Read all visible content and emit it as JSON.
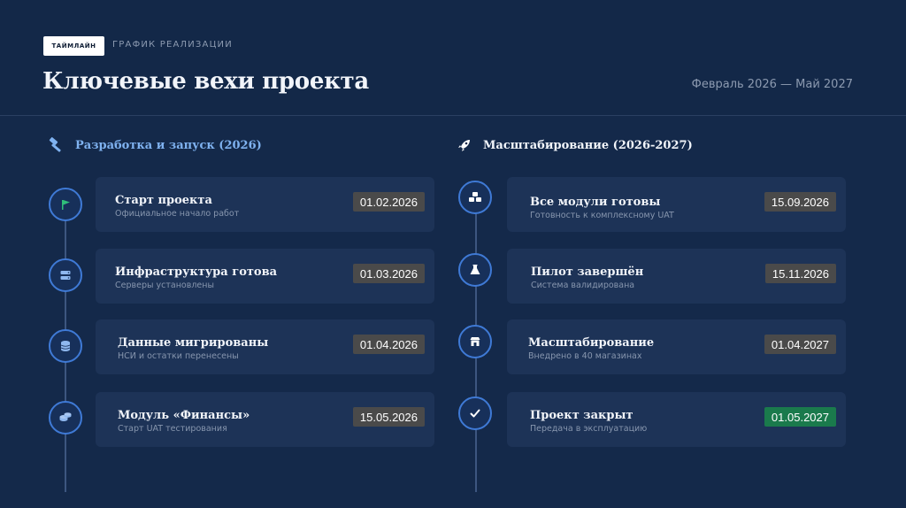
{
  "header": {
    "tag": "ТАЙМЛАЙН",
    "kicker": "ГРАФИК РЕАЛИЗАЦИИ",
    "title": "Ключевые вехи проекта",
    "date_range": "Февраль 2026 — Май 2027"
  },
  "left": {
    "heading": "Разработка и запуск (2026)",
    "heading_icon": "hammer-icon",
    "items": [
      {
        "title": "Старт проекта",
        "subtitle": "Официальное начало работ",
        "date": "01.02.2026",
        "icon": "flag-icon"
      },
      {
        "title": "Инфраструктура готова",
        "subtitle": "Серверы установлены",
        "date": "01.03.2026",
        "icon": "server-icon"
      },
      {
        "title": "Данные мигрированы",
        "subtitle": "НСИ и остатки перенесены",
        "date": "01.04.2026",
        "icon": "database-icon"
      },
      {
        "title": "Модуль «Финансы»",
        "subtitle": "Старт UAT тестирования",
        "date": "15.05.2026",
        "icon": "coins-icon"
      }
    ]
  },
  "right": {
    "heading": "Масштабирование (2026-2027)",
    "heading_icon": "rocket-icon",
    "items": [
      {
        "title": "Все модули готовы",
        "subtitle": "Готовность к комплексному UAT",
        "date": "15.09.2026",
        "icon": "cubes-icon"
      },
      {
        "title": "Пилот завершён",
        "subtitle": "Система валидирована",
        "date": "15.11.2026",
        "icon": "flask-icon"
      },
      {
        "title": "Масштабирование",
        "subtitle": "Внедрено в 40 магазинах",
        "date": "01.04.2027",
        "icon": "store-icon"
      },
      {
        "title": "Проект закрыт",
        "subtitle": "Передача в эксплуатацию",
        "date": "01.05.2027",
        "icon": "check-icon",
        "status_color": "#1a7a4c"
      }
    ]
  },
  "colors": {
    "background": "#14294a",
    "card": "#1d3357",
    "accent": "#3f7ad6",
    "date_badge": "#4a4a4a",
    "done_badge": "#1a7a4c",
    "heading_accent": "#7fb2f0"
  }
}
